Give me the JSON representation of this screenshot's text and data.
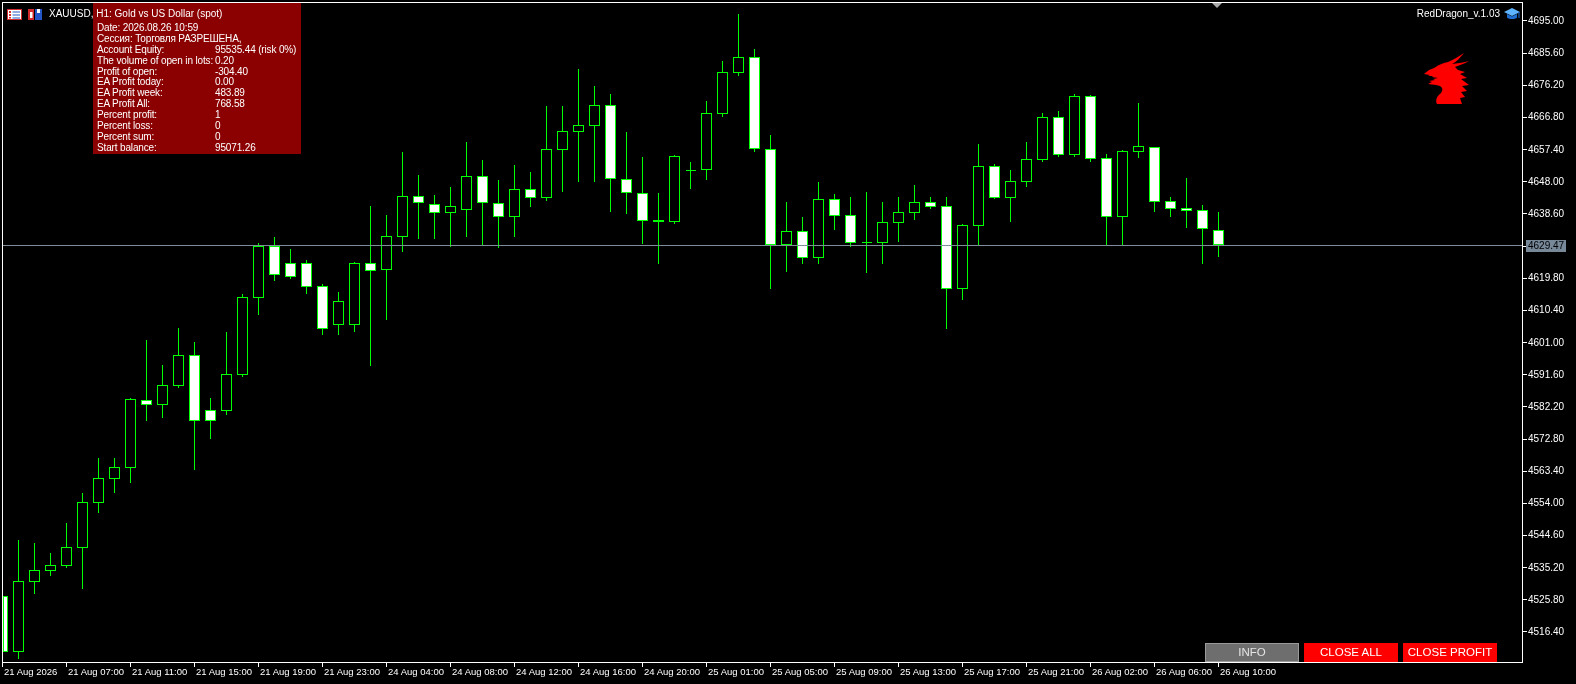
{
  "chart": {
    "title": "XAUUSD, H1: Gold vs US Dollar (spot)",
    "expert": "RedDragon_v.1.03"
  },
  "info_panel": {
    "lines": [
      "Date: 2026.08.26 10:59",
      "Сессия: Торговля РАЗРЕШЕНА,"
    ],
    "rows": [
      {
        "label": "Account Equity:",
        "value": "95535.44 (risk 0%)"
      },
      {
        "label": "The volume of open in lots:",
        "value": "0.20"
      },
      {
        "label": "Profit of open:",
        "value": "-304.40"
      },
      {
        "label": "EA Profit today:",
        "value": "0.00"
      },
      {
        "label": "EA Profit week:",
        "value": "483.89"
      },
      {
        "label": "EA Profit All:",
        "value": "768.58"
      },
      {
        "label": "Percent profit:",
        "value": "1"
      },
      {
        "label": "Percent loss:",
        "value": "0"
      },
      {
        "label": "Percent sum:",
        "value": "0"
      },
      {
        "label": "Start balance:",
        "value": "95071.26"
      }
    ]
  },
  "buttons": [
    {
      "label": "INFO",
      "kind": "info"
    },
    {
      "label": "CLOSE ALL",
      "kind": "close"
    },
    {
      "label": "CLOSE PROFIT",
      "kind": "close"
    }
  ],
  "price_axis": [
    {
      "label": "4695.00",
      "kind": "tick"
    },
    {
      "label": "4685.60",
      "kind": "tick"
    },
    {
      "label": "4676.20",
      "kind": "tick"
    },
    {
      "label": "4666.80",
      "kind": "tick"
    },
    {
      "label": "4657.40",
      "kind": "tick"
    },
    {
      "label": "4648.00",
      "kind": "tick"
    },
    {
      "label": "4638.60",
      "kind": "tick"
    },
    {
      "label": "4629.47",
      "kind": "current"
    },
    {
      "label": "4619.80",
      "kind": "tick"
    },
    {
      "label": "4610.40",
      "kind": "tick"
    },
    {
      "label": "4601.00",
      "kind": "tick"
    },
    {
      "label": "4591.60",
      "kind": "tick"
    },
    {
      "label": "4582.20",
      "kind": "tick"
    },
    {
      "label": "4572.80",
      "kind": "tick"
    },
    {
      "label": "4563.40",
      "kind": "tick"
    },
    {
      "label": "4554.00",
      "kind": "tick"
    },
    {
      "label": "4544.60",
      "kind": "tick"
    },
    {
      "label": "4535.20",
      "kind": "tick"
    },
    {
      "label": "4525.80",
      "kind": "tick"
    },
    {
      "label": "4516.40",
      "kind": "tick"
    }
  ],
  "time_axis": [
    "21 Aug 2026",
    "21 Aug 07:00",
    "21 Aug 11:00",
    "21 Aug 15:00",
    "21 Aug 19:00",
    "21 Aug 23:00",
    "24 Aug 04:00",
    "24 Aug 08:00",
    "24 Aug 12:00",
    "24 Aug 16:00",
    "24 Aug 20:00",
    "25 Aug 01:00",
    "25 Aug 05:00",
    "25 Aug 09:00",
    "25 Aug 13:00",
    "25 Aug 17:00",
    "25 Aug 21:00",
    "26 Aug 02:00",
    "26 Aug 06:00",
    "26 Aug 10:00"
  ]
}
